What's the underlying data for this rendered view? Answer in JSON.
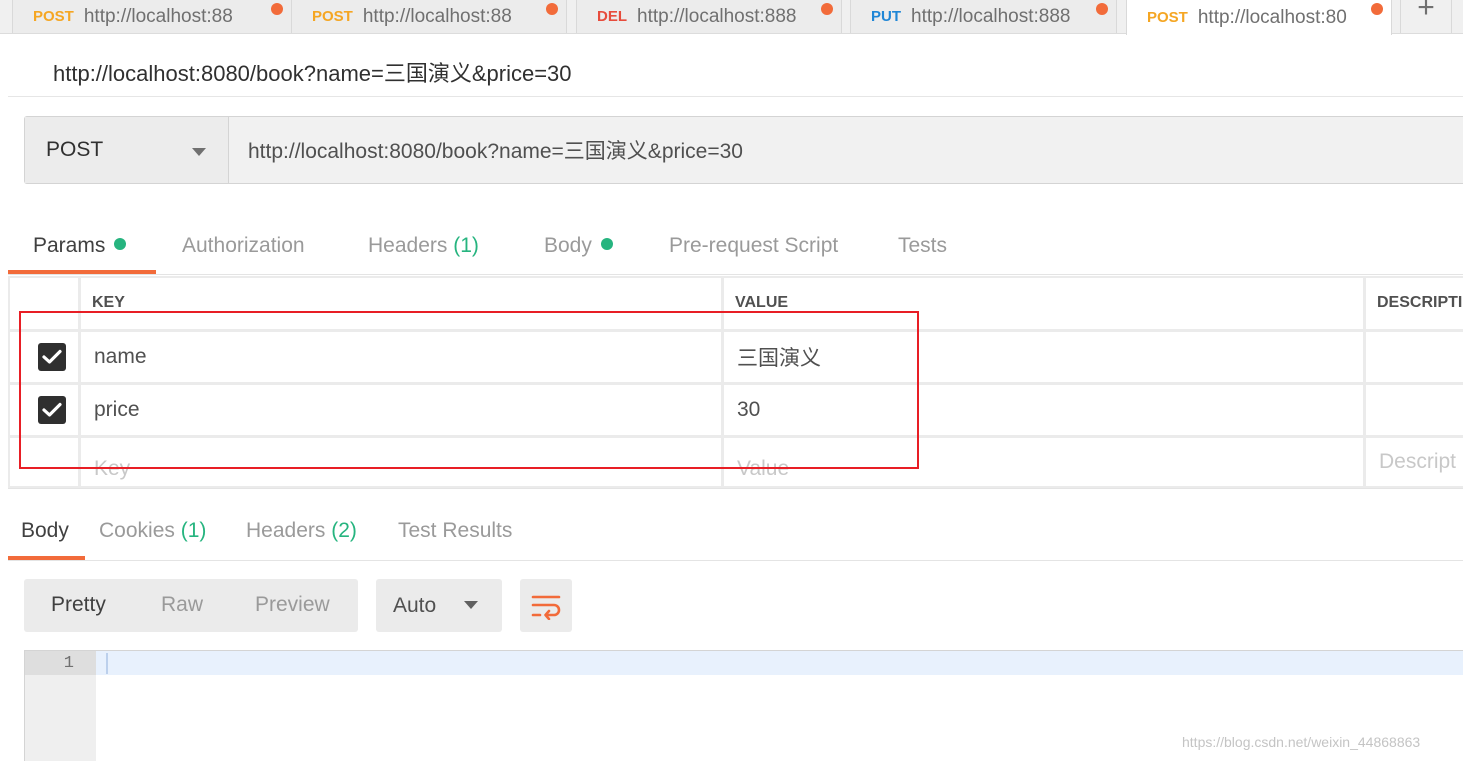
{
  "tabs": [
    {
      "method": "POST",
      "method_color": "#f5a623",
      "url": "http://localhost:88"
    },
    {
      "method": "POST",
      "method_color": "#f5a623",
      "url": "http://localhost:88"
    },
    {
      "method": "DEL",
      "method_color": "#e74c3c",
      "url": "http://localhost:888"
    },
    {
      "method": "PUT",
      "method_color": "#1f86d6",
      "url": "http://localhost:888"
    },
    {
      "method": "POST",
      "method_color": "#f5a623",
      "url": "http://localhost:80"
    }
  ],
  "new_tab_label": "+",
  "request": {
    "title": "http://localhost:8080/book?name=三国演义&price=30",
    "method": "POST",
    "url": "http://localhost:8080/book?name=三国演义&price=30"
  },
  "request_tabs": {
    "params": "Params",
    "authorization": "Authorization",
    "headers": "Headers",
    "headers_count": "(1)",
    "body": "Body",
    "prerequest": "Pre-request Script",
    "tests": "Tests"
  },
  "params_table": {
    "headers": {
      "key": "KEY",
      "value": "VALUE",
      "description": "DESCRIPTI"
    },
    "rows": [
      {
        "key": "name",
        "value": "三国演义",
        "checked": true
      },
      {
        "key": "price",
        "value": "30",
        "checked": true
      }
    ],
    "placeholders": {
      "key": "Key",
      "value": "Value",
      "description": "Descript"
    }
  },
  "response_tabs": {
    "body": "Body",
    "cookies": "Cookies",
    "cookies_count": "(1)",
    "headers": "Headers",
    "headers_count": "(2)",
    "test_results": "Test Results"
  },
  "view_modes": {
    "pretty": "Pretty",
    "raw": "Raw",
    "preview": "Preview"
  },
  "format": "Auto",
  "editor": {
    "line_number": "1"
  },
  "watermark": "https://blog.csdn.net/weixin_44868863",
  "colors": {
    "accent": "#f26b3a",
    "green": "#26b47f",
    "highlight_box": "#e81e25"
  }
}
